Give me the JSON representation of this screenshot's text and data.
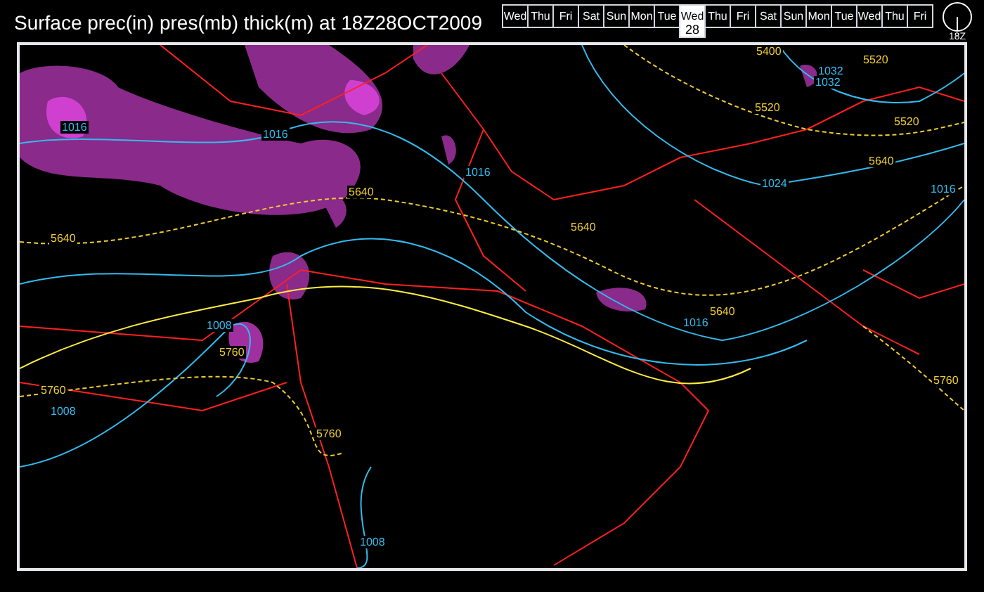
{
  "title": "Surface prec(in) pres(mb) thick(m) at 18Z28OCT2009",
  "days": [
    {
      "label": "Wed",
      "selected": false
    },
    {
      "label": "Thu",
      "selected": false
    },
    {
      "label": "Fri",
      "selected": false
    },
    {
      "label": "Sat",
      "selected": false
    },
    {
      "label": "Sun",
      "selected": false
    },
    {
      "label": "Mon",
      "selected": false
    },
    {
      "label": "Tue",
      "selected": false
    },
    {
      "label": "Wed",
      "date": "28",
      "selected": true
    },
    {
      "label": "Thu",
      "selected": false
    },
    {
      "label": "Fri",
      "selected": false
    },
    {
      "label": "Sat",
      "selected": false
    },
    {
      "label": "Sun",
      "selected": false
    },
    {
      "label": "Mon",
      "selected": false
    },
    {
      "label": "Tue",
      "selected": false
    },
    {
      "label": "Wed",
      "selected": false
    },
    {
      "label": "Thu",
      "selected": false
    },
    {
      "label": "Fri",
      "selected": false
    }
  ],
  "clock": {
    "label": "18Z"
  },
  "map_labels": [
    {
      "text": "1016",
      "kind": "isobar"
    },
    {
      "text": "1016",
      "kind": "isobar"
    },
    {
      "text": "1016",
      "kind": "isobar"
    },
    {
      "text": "5640",
      "kind": "thickness"
    },
    {
      "text": "5640",
      "kind": "thickness"
    },
    {
      "text": "5640",
      "kind": "thickness"
    },
    {
      "text": "1008",
      "kind": "isobar"
    },
    {
      "text": "5760",
      "kind": "thickness"
    },
    {
      "text": "5760",
      "kind": "thickness"
    },
    {
      "text": "1008",
      "kind": "isobar"
    },
    {
      "text": "5760",
      "kind": "thickness"
    },
    {
      "text": "1008",
      "kind": "isobar"
    },
    {
      "text": "5400",
      "kind": "thickness"
    },
    {
      "text": "5520",
      "kind": "thickness"
    },
    {
      "text": "1032",
      "kind": "isobar"
    },
    {
      "text": "1032",
      "kind": "isobar"
    },
    {
      "text": "5520",
      "kind": "thickness"
    },
    {
      "text": "5520",
      "kind": "thickness"
    },
    {
      "text": "1024",
      "kind": "isobar"
    },
    {
      "text": "5640",
      "kind": "thickness"
    },
    {
      "text": "1016",
      "kind": "isobar"
    },
    {
      "text": "5640",
      "kind": "thickness"
    },
    {
      "text": "1016",
      "kind": "isobar"
    },
    {
      "text": "5760",
      "kind": "thickness"
    }
  ]
}
